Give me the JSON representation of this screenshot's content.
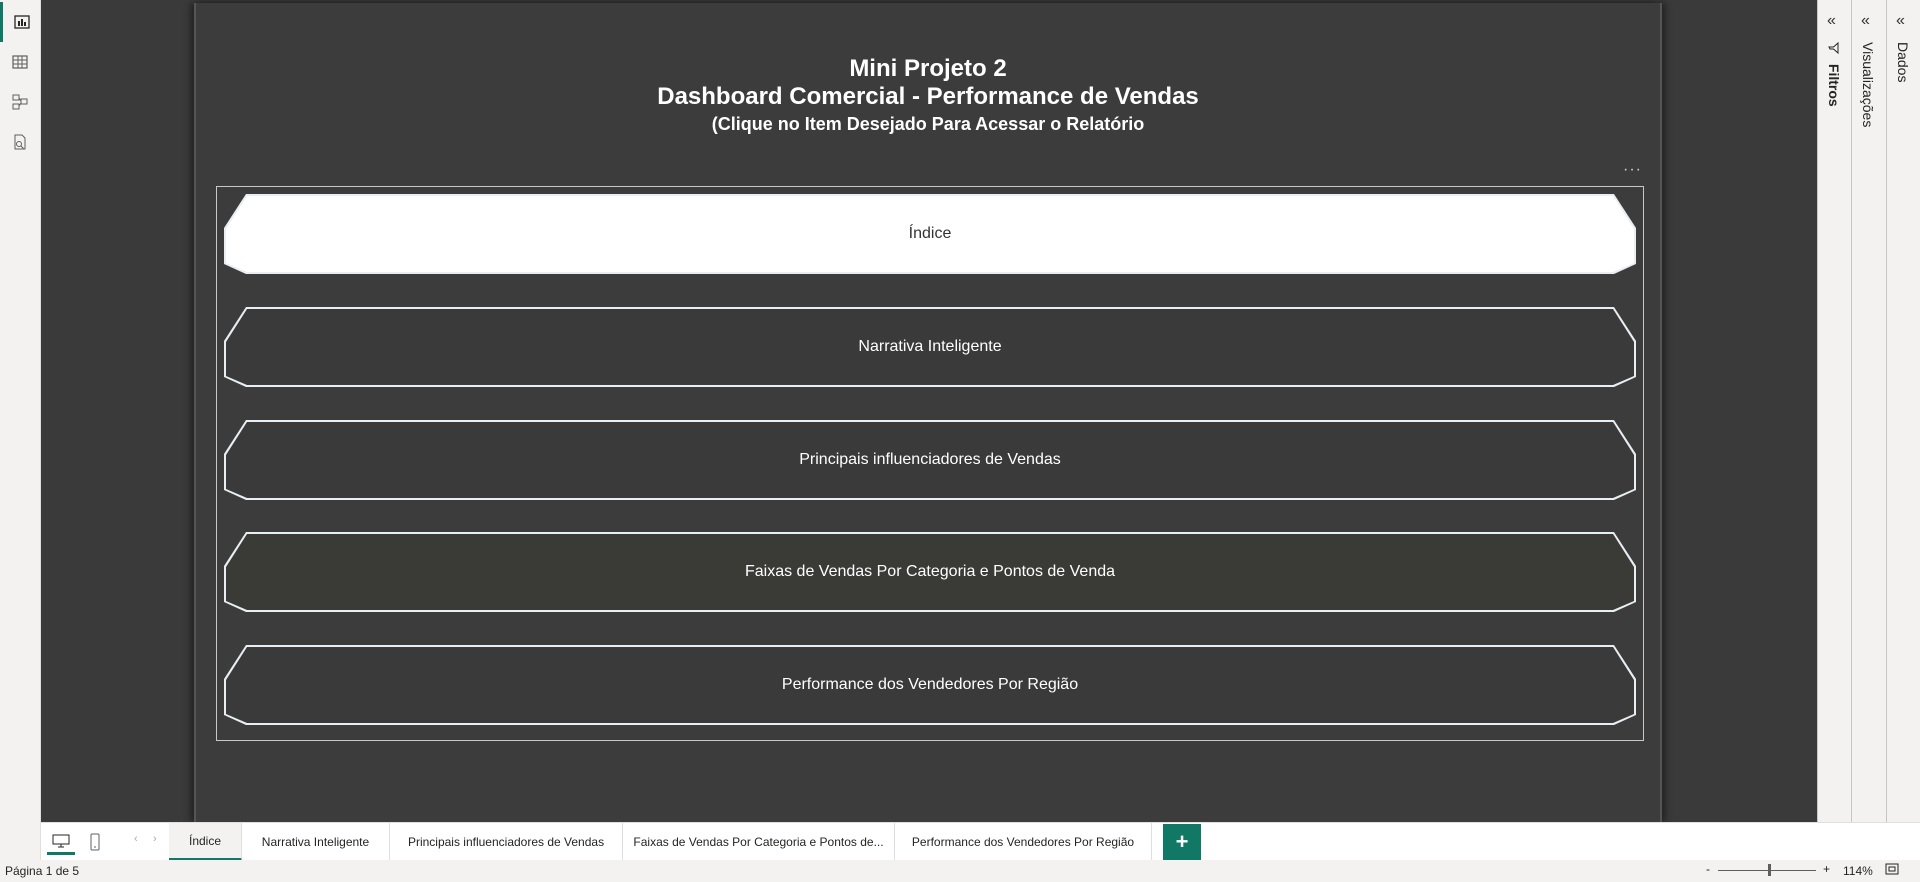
{
  "left_rail": {
    "items": [
      {
        "icon": "report-view-icon",
        "active": true
      },
      {
        "icon": "table-view-icon",
        "active": false
      },
      {
        "icon": "model-view-icon",
        "active": false
      },
      {
        "icon": "dax-query-icon",
        "active": false
      }
    ]
  },
  "report": {
    "title_line_1": "Mini Projeto 2",
    "title_line_2": "Dashboard Comercial - Performance de Vendas",
    "title_line_3": "(Clique no Item Desejado Para Acessar o Relatório",
    "more_options": "···",
    "nav_buttons": [
      {
        "label": "Índice",
        "selected": true
      },
      {
        "label": "Narrativa Inteligente",
        "selected": false
      },
      {
        "label": "Principais influenciadores de Vendas",
        "selected": false
      },
      {
        "label": "Faixas de Vendas Por Categoria e Pontos de Venda",
        "selected": false
      },
      {
        "label": "Performance dos Vendedores Por Região",
        "selected": false
      }
    ]
  },
  "right_panes": {
    "filters_label": "Filtros",
    "visualizations_label": "Visualizações",
    "data_label": "Dados",
    "collapse_glyph": "«"
  },
  "page_tabs": {
    "tabs": [
      {
        "label": "Índice",
        "active": true
      },
      {
        "label": "Narrativa Inteligente",
        "active": false
      },
      {
        "label": "Principais influenciadores de Vendas",
        "active": false
      },
      {
        "label": "Faixas de Vendas Por Categoria e Pontos de...",
        "active": false
      },
      {
        "label": "Performance dos Vendedores Por Região",
        "active": false
      }
    ],
    "add_label": "+",
    "prev_arrow": "‹",
    "next_arrow": "›"
  },
  "status_bar": {
    "page_count": "Página 1 de 5",
    "zoom_minus": "-",
    "zoom_plus": "+",
    "zoom_value": "114%"
  },
  "colors": {
    "accent": "#117865",
    "canvas_bg": "#3a3a3a",
    "page_bg": "#3c3c3c"
  }
}
